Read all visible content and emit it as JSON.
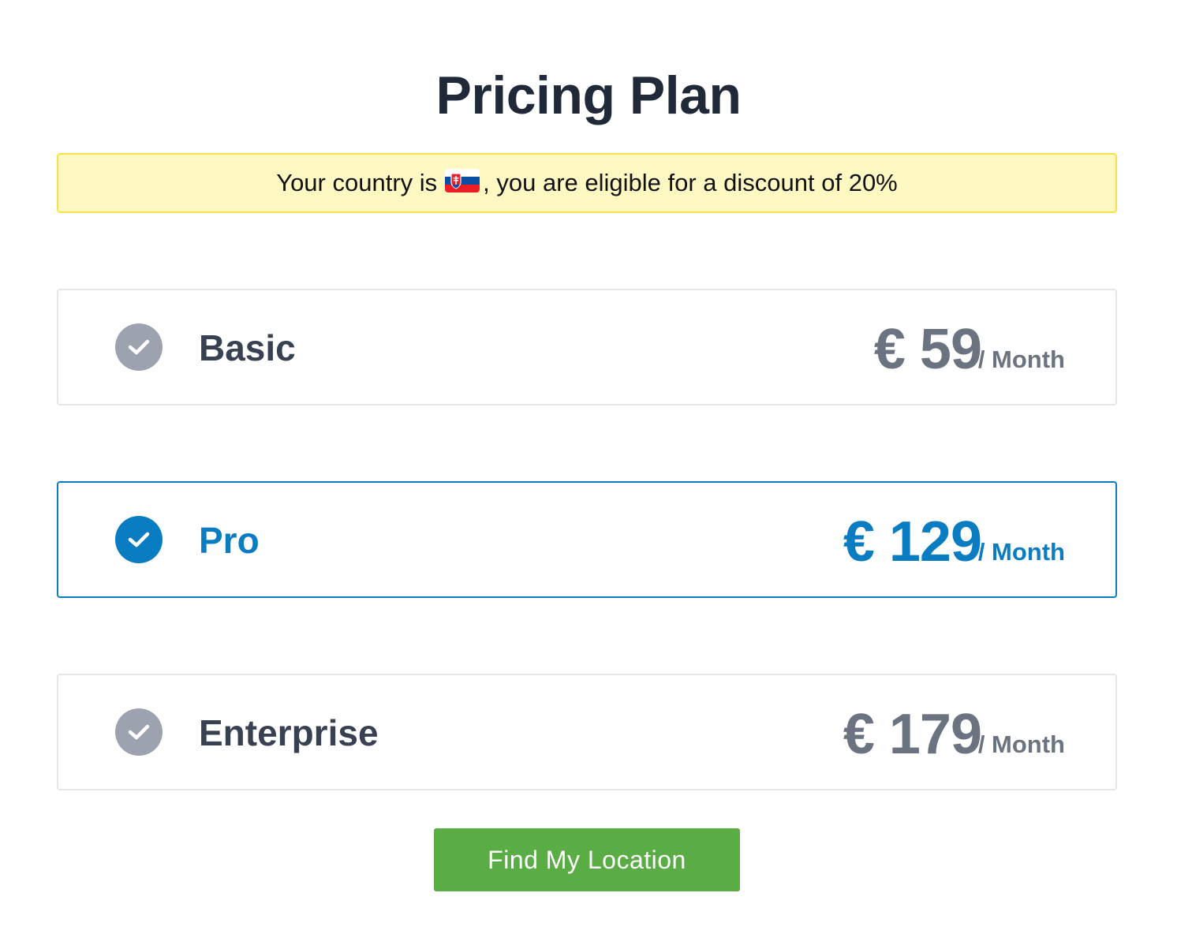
{
  "header": {
    "title": "Pricing Plan"
  },
  "banner": {
    "prefix": "Your country is",
    "flag_icon": "slovakia-flag-icon",
    "suffix": ", you are eligible for a discount of 20%"
  },
  "plans": [
    {
      "name": "Basic",
      "price": "€ 59",
      "period": "/ Month",
      "selected": false
    },
    {
      "name": "Pro",
      "price": "€ 129",
      "period": "/ Month",
      "selected": true
    },
    {
      "name": "Enterprise",
      "price": "€ 179",
      "period": "/ Month",
      "selected": false
    }
  ],
  "actions": {
    "find_location_label": "Find My Location"
  },
  "colors": {
    "accent": "#0a7cc2",
    "muted": "#9ca3af",
    "button": "#5aad45",
    "banner_bg": "#fef9c3",
    "banner_border": "#fde047"
  }
}
